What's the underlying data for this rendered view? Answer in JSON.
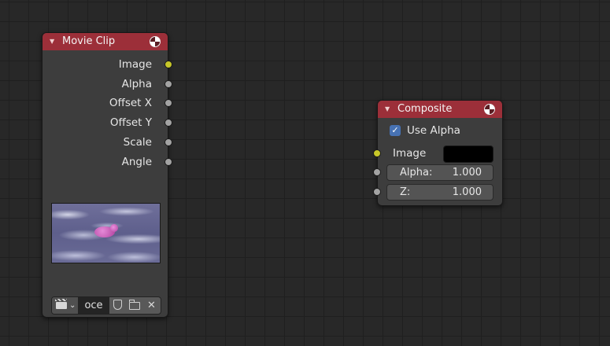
{
  "movie_clip_node": {
    "title": "Movie Clip",
    "outputs": [
      {
        "label": "Image",
        "socket": "yellow"
      },
      {
        "label": "Alpha",
        "socket": "gray"
      },
      {
        "label": "Offset X",
        "socket": "gray"
      },
      {
        "label": "Offset Y",
        "socket": "gray"
      },
      {
        "label": "Scale",
        "socket": "gray"
      },
      {
        "label": "Angle",
        "socket": "gray"
      }
    ],
    "clip_name": "oce",
    "icons": {
      "dropdown": "movie-clip-icon",
      "fake_user": "shield-icon",
      "open": "folder-icon",
      "unlink": "close-icon"
    },
    "unlink_glyph": "✕"
  },
  "composite_node": {
    "title": "Composite",
    "use_alpha_label": "Use Alpha",
    "use_alpha_checked": true,
    "image_label": "Image",
    "image_color": "#000000",
    "alpha_label": "Alpha:",
    "alpha_value": "1.000",
    "z_label": "Z:",
    "z_value": "1.000"
  },
  "colors": {
    "node_header": "#9c2f39",
    "node_body": "#3d3d3d",
    "socket_image": "#c7c729",
    "socket_value": "#a3a3a3",
    "checkbox": "#4772b3"
  }
}
